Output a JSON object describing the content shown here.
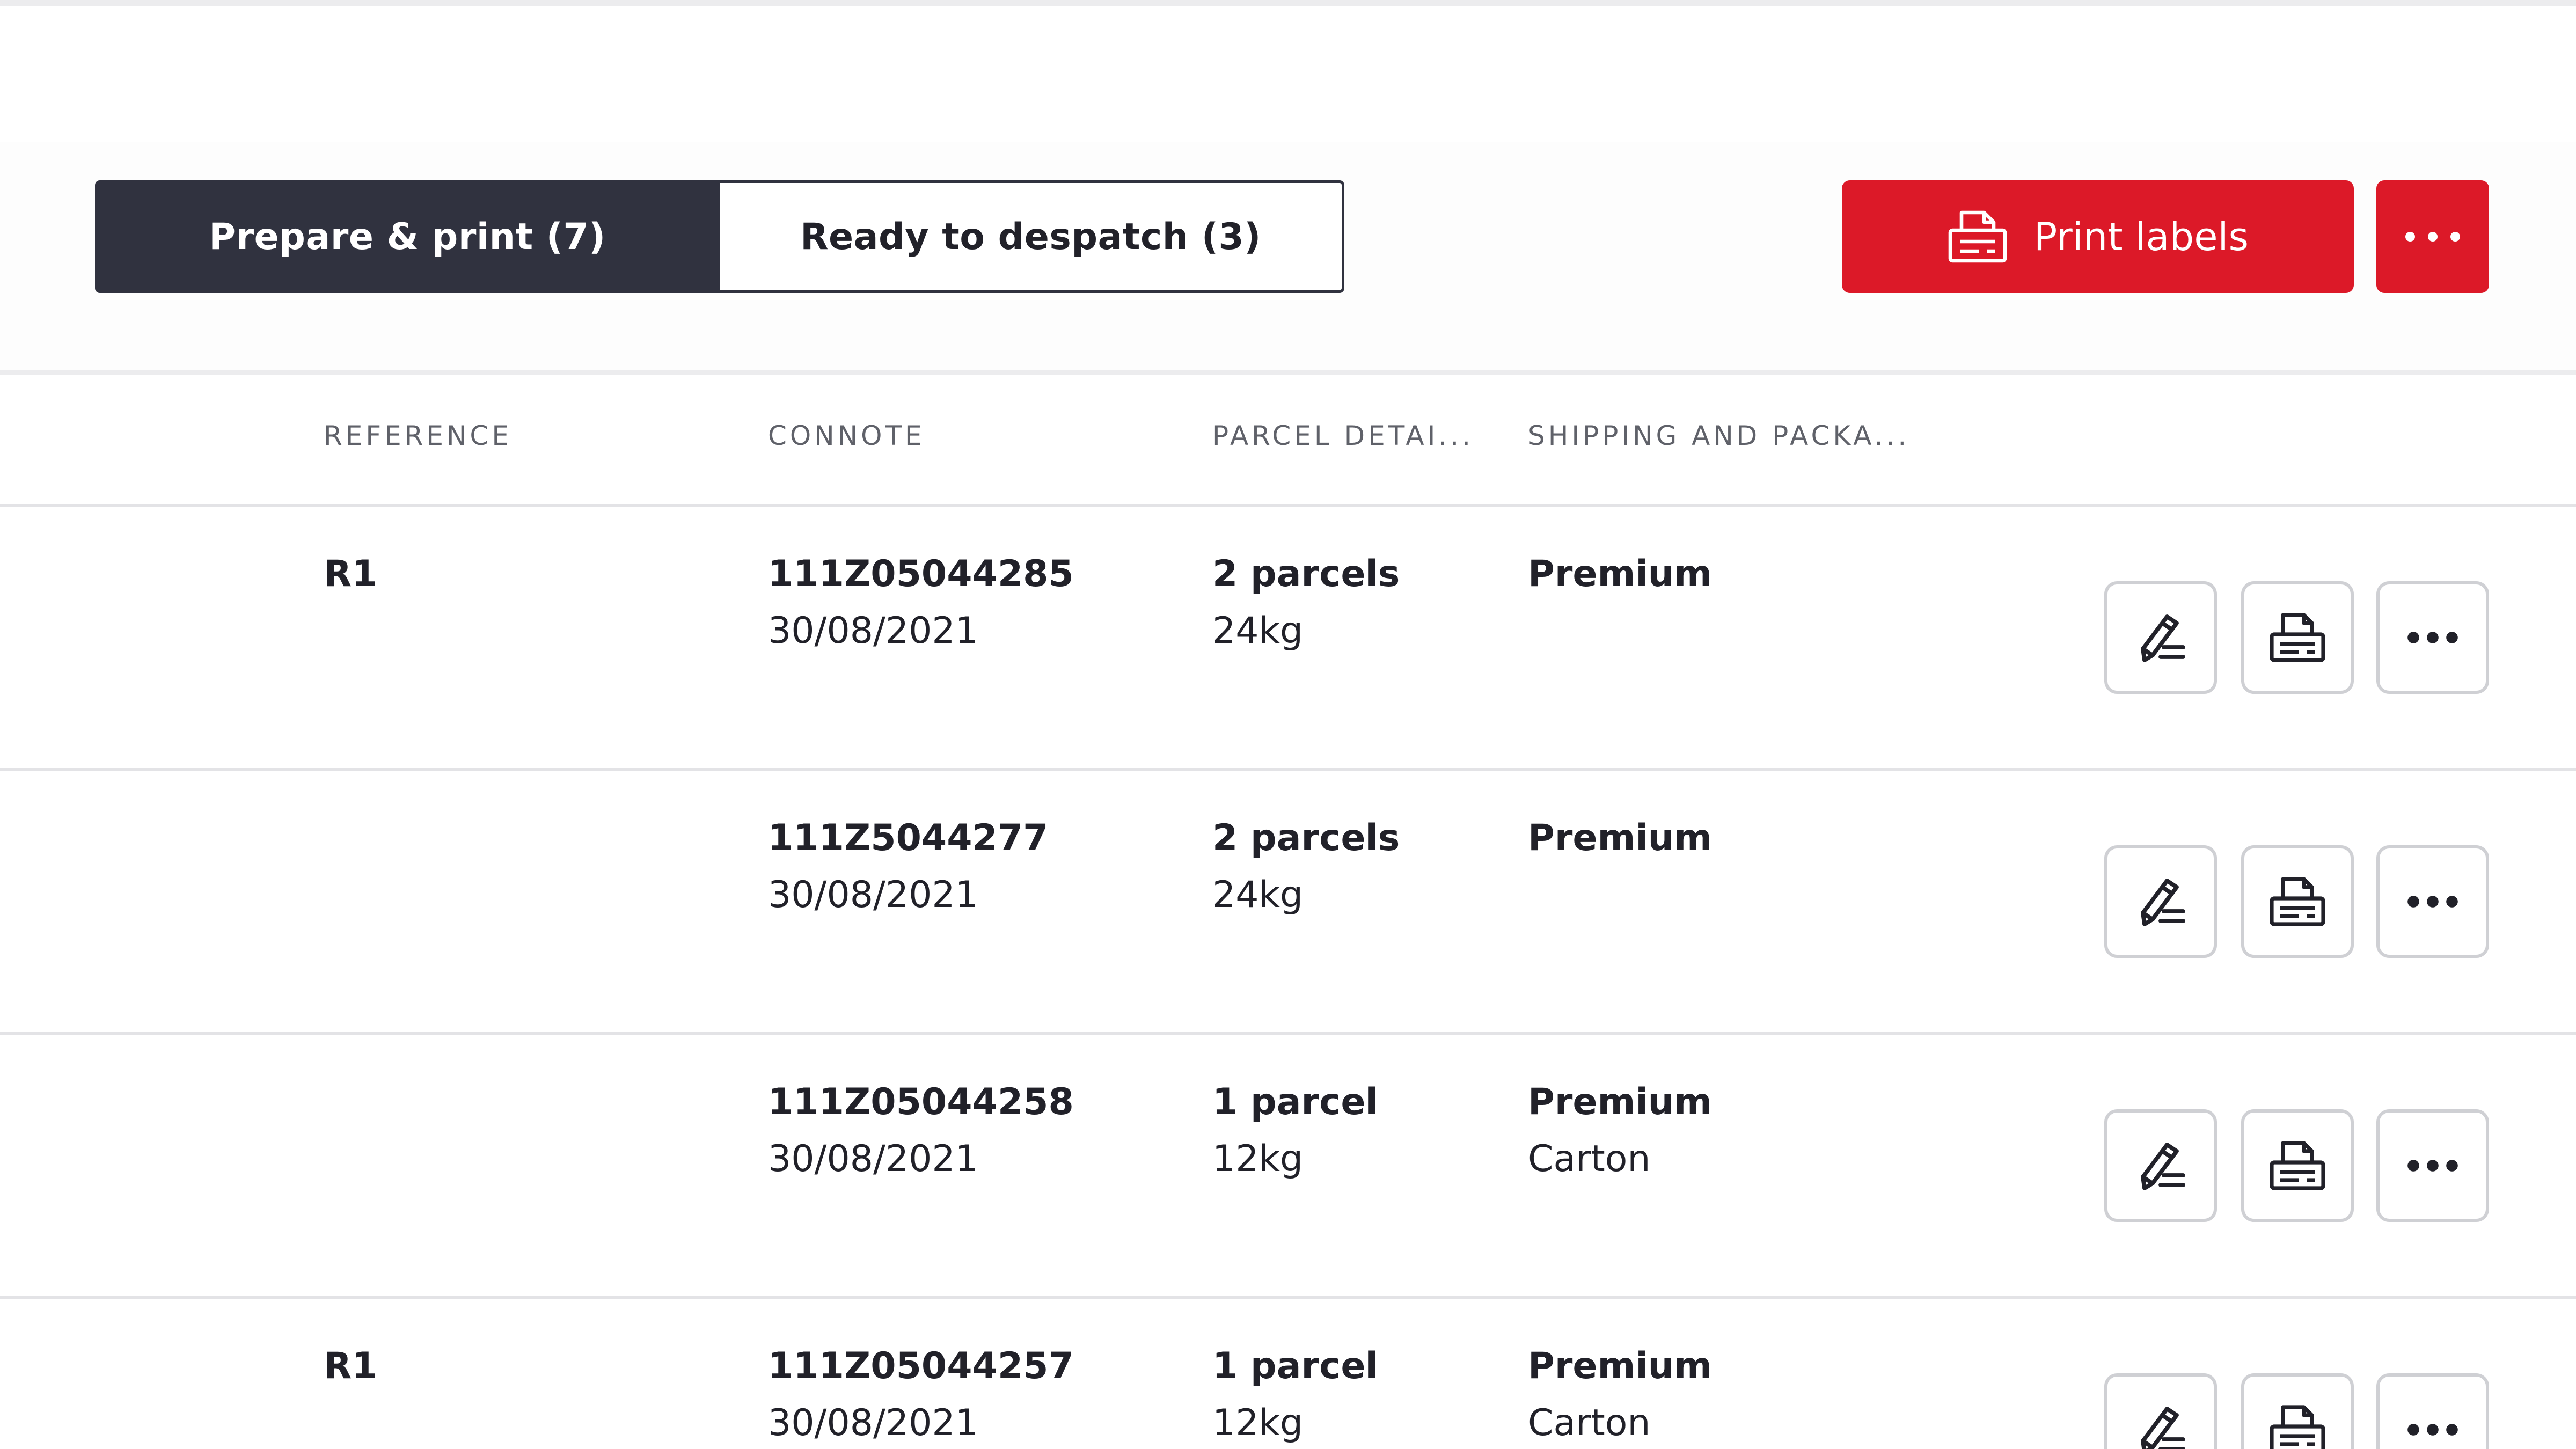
{
  "tabs": [
    {
      "label": "Prepare & print (7)",
      "active": true
    },
    {
      "label": "Ready to despatch (3)",
      "active": false
    }
  ],
  "toolbar": {
    "print_label": "Print labels",
    "print_icon": "printer-icon",
    "more_icon": "ellipsis-icon",
    "accent_color": "#dc1928"
  },
  "columns": [
    "REFERENCE",
    "CONNOTE",
    "PARCEL DETAI...",
    "SHIPPING AND PACKA..."
  ],
  "rows": [
    {
      "reference": "R1",
      "connote": "111Z05044285",
      "date": "30/08/2021",
      "parcels": "2 parcels",
      "weight": "24kg",
      "service": "Premium",
      "packaging": ""
    },
    {
      "reference": "",
      "connote": "111Z5044277",
      "date": "30/08/2021",
      "parcels": "2 parcels",
      "weight": "24kg",
      "service": "Premium",
      "packaging": ""
    },
    {
      "reference": "",
      "connote": "111Z05044258",
      "date": "30/08/2021",
      "parcels": "1 parcel",
      "weight": "12kg",
      "service": "Premium",
      "packaging": "Carton"
    },
    {
      "reference": "R1",
      "connote": "111Z05044257",
      "date": "30/08/2021",
      "parcels": "1 parcel",
      "weight": "12kg",
      "service": "Premium",
      "packaging": "Carton"
    }
  ],
  "row_action_icons": [
    "edit-icon",
    "printer-icon",
    "ellipsis-icon"
  ]
}
